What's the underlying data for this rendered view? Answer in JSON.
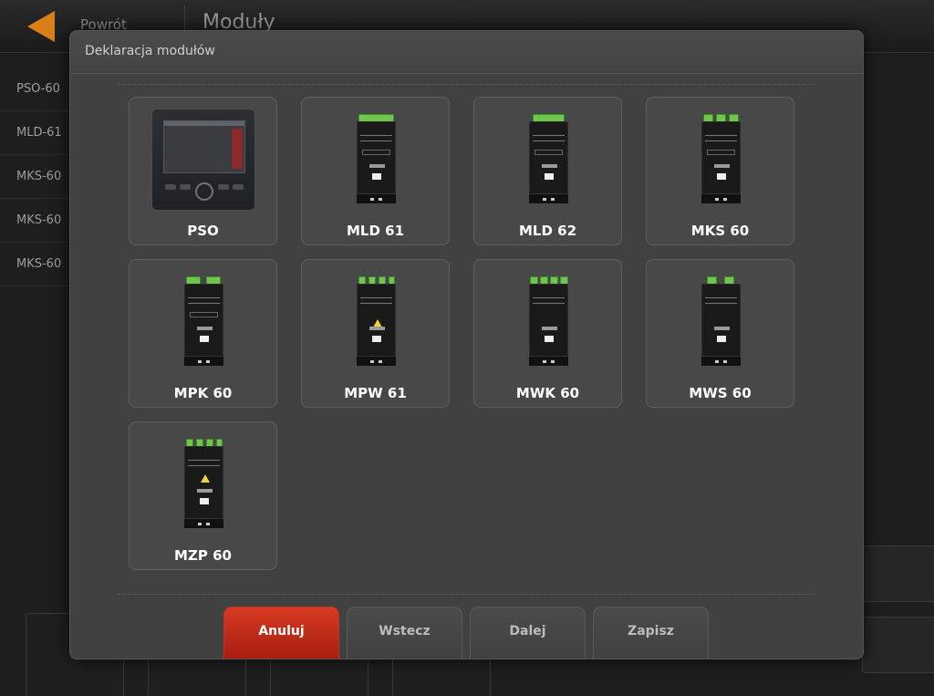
{
  "app": {
    "back_label": "Powrót",
    "title": "Moduły"
  },
  "background_list": [
    "PSO-60",
    "MLD-61",
    "MKS-60",
    "MKS-60",
    "MKS-60"
  ],
  "dialog": {
    "title": "Deklaracja modułów",
    "modules": [
      {
        "label": "PSO"
      },
      {
        "label": "MLD 61"
      },
      {
        "label": "MLD 62"
      },
      {
        "label": "MKS 60"
      },
      {
        "label": "MPK 60"
      },
      {
        "label": "MPW 61"
      },
      {
        "label": "MWK 60"
      },
      {
        "label": "MWS 60"
      },
      {
        "label": "MZP 60"
      }
    ],
    "buttons": {
      "cancel": "Anuluj",
      "back": "Wstecz",
      "next": "Dalej",
      "save": "Zapisz"
    }
  },
  "colors": {
    "accent_orange": "#d97f1a",
    "cancel_red": "#c73520",
    "terminal_green": "#6ec74c"
  },
  "icons": {
    "back": "back-arrow-icon"
  }
}
